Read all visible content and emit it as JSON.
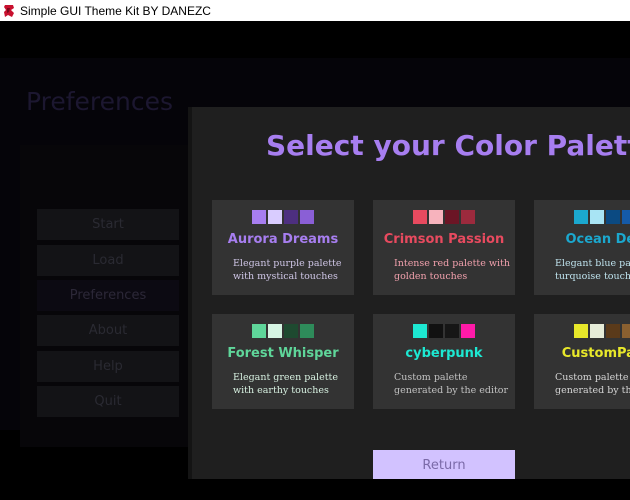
{
  "window": {
    "title": "Simple GUI Theme Kit BY DANEZC"
  },
  "background": {
    "heading": "Preferences",
    "menu": [
      {
        "label": "Start"
      },
      {
        "label": "Load"
      },
      {
        "label": "Preferences",
        "active": true
      },
      {
        "label": "About"
      },
      {
        "label": "Help"
      },
      {
        "label": "Quit"
      }
    ]
  },
  "dialog": {
    "title": "Select your Color Palette",
    "return_label": "Return",
    "palettes": [
      {
        "name": "Aurora Dreams",
        "desc": "Elegant purple palette with mystical touches",
        "name_color": "#a77ef0",
        "desc_color": "#cfc6e6",
        "colors": [
          "#a77ef0",
          "#d9ccff",
          "#4d2f80",
          "#8a5fd6"
        ]
      },
      {
        "name": "Crimson Passion",
        "desc": "Intense red palette with golden touches",
        "name_color": "#e84a5f",
        "desc_color": "#f0a0ac",
        "colors": [
          "#e84a5f",
          "#f7b3bd",
          "#6b1525",
          "#9c2a3d"
        ]
      },
      {
        "name": "Ocean Dep",
        "desc": "Elegant blue palett turquoise touches",
        "name_color": "#1ba8cf",
        "desc_color": "#bfe3ee",
        "colors": [
          "#1ba8cf",
          "#a8e4f4",
          "#0b4a82",
          "#155aa8"
        ]
      },
      {
        "name": "Forest Whisper",
        "desc": "Elegant green palette with earthy touches",
        "name_color": "#5fd69a",
        "desc_color": "#d8f2e2",
        "colors": [
          "#5fd69a",
          "#d6f5e3",
          "#1e4a30",
          "#2e8b5a"
        ]
      },
      {
        "name": "cyberpunk",
        "desc": "Custom palette generated by the editor",
        "name_color": "#1de8d2",
        "desc_color": "#c2c2c2",
        "colors": [
          "#1de8d2",
          "#111111",
          "#161616",
          "#ff1aa8"
        ]
      },
      {
        "name": "CustomPale",
        "desc": "Custom palette generated by the e",
        "name_color": "#e8e82a",
        "desc_color": "#d6d6d6",
        "colors": [
          "#e8e82a",
          "#e6ecd8",
          "#5a3a1a",
          "#8a6030"
        ]
      }
    ]
  }
}
